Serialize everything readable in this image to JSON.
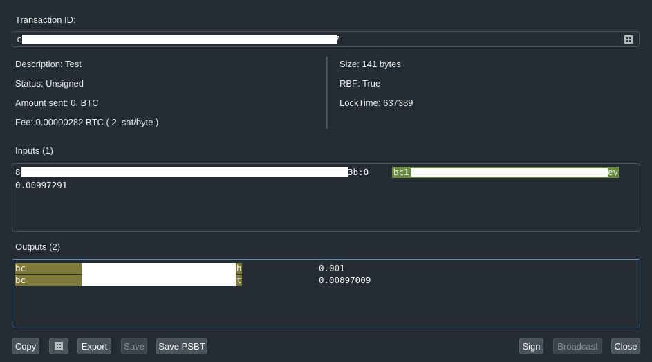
{
  "labels": {
    "transaction_id": "Transaction ID:",
    "inputs": "Inputs (1)",
    "outputs": "Outputs (2)"
  },
  "txid": {
    "start": "c",
    "end": "7"
  },
  "details_left": {
    "description": "Description: Test",
    "status": "Status: Unsigned",
    "amount": "Amount sent: 0. BTC",
    "fee": "Fee: 0.00000282 BTC  ( 2. sat/byte )"
  },
  "details_right": {
    "size": "Size: 141 bytes",
    "rbf": "RBF: True",
    "locktime": "LockTime: 637389"
  },
  "inputs": [
    {
      "prevout_start": "8",
      "prevout_end": "3b:0",
      "address_start": "bc1",
      "address_end": "ev",
      "amount": "0.00997291"
    }
  ],
  "outputs": [
    {
      "address_start": "bc",
      "address_end": "h",
      "amount": "0.001"
    },
    {
      "address_start": "bc",
      "address_end": "t",
      "amount": "0.00897009"
    }
  ],
  "buttons": {
    "copy": "Copy",
    "export": "Export",
    "save": "Save",
    "save_psbt": "Save PSBT",
    "sign": "Sign",
    "broadcast": "Broadcast",
    "close": "Close"
  },
  "icons": {
    "qr": "qr-code-icon"
  },
  "colors": {
    "background": "#252c33",
    "input_address_highlight": "#6b8a3e",
    "output_address_highlight": "#7d7a3a",
    "focus_border": "#5b8ec4"
  }
}
